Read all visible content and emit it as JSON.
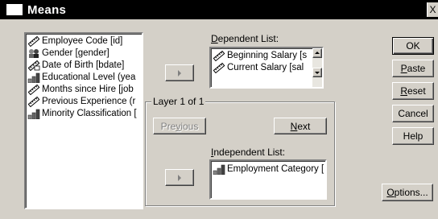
{
  "window": {
    "title": "Means",
    "close_glyph": "X"
  },
  "source_list": {
    "items": [
      {
        "label": "Employee Code [id]",
        "icon": "ruler-icon"
      },
      {
        "label": "Gender [gender]",
        "icon": "nominal-scale-icon"
      },
      {
        "label": "Date of Birth [bdate]",
        "icon": "calendar-icon"
      },
      {
        "label": "Educational Level (yea",
        "icon": "ordinal-bars-icon"
      },
      {
        "label": "Months since Hire [job",
        "icon": "ruler-icon"
      },
      {
        "label": "Previous Experience (r",
        "icon": "ruler-icon"
      },
      {
        "label": "Minority Classification [",
        "icon": "ordinal-bars-icon"
      }
    ]
  },
  "dependent": {
    "label_prefix": "",
    "label_mnemonic": "D",
    "label_rest": "ependent List:",
    "items": [
      {
        "label": "Beginning Salary [s",
        "icon": "ruler-icon"
      },
      {
        "label": "Current Salary [sal",
        "icon": "ruler-icon"
      }
    ]
  },
  "layer": {
    "title": "Layer 1 of 1",
    "previous_mnemonic": "v",
    "previous_pre": "Pre",
    "previous_post": "ious",
    "next_mnemonic": "N",
    "next_rest": "ext"
  },
  "independent": {
    "label_mnemonic": "I",
    "label_rest": "ndependent List:",
    "items": [
      {
        "label": "Employment Category [",
        "icon": "ordinal-bars-icon"
      }
    ]
  },
  "buttons": {
    "ok": "OK",
    "paste_mnemonic": "P",
    "paste_rest": "aste",
    "reset_mnemonic": "R",
    "reset_rest": "eset",
    "cancel": "Cancel",
    "help": "Help",
    "options_mnemonic": "O",
    "options_rest": "ptions..."
  },
  "colors": {
    "face": "#d4d0c8",
    "title_bg": "#000000",
    "disabled": "#808080"
  }
}
